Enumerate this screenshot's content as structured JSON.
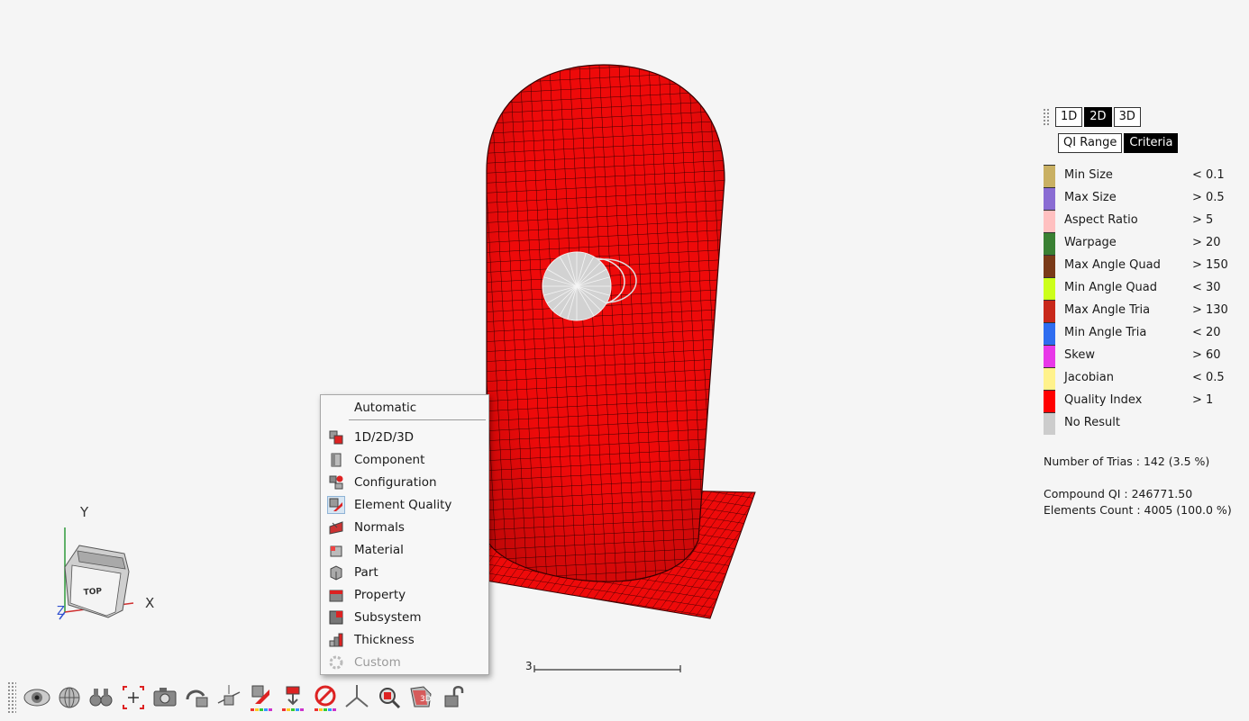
{
  "dimension_tabs": [
    {
      "label": "1D",
      "active": false
    },
    {
      "label": "2D",
      "active": true
    },
    {
      "label": "3D",
      "active": false
    }
  ],
  "mode_tabs": [
    {
      "label": "QI Range",
      "active": false
    },
    {
      "label": "Criteria",
      "active": true
    }
  ],
  "legend": [
    {
      "label": "Min Size",
      "op": "<",
      "value": "0.1",
      "color": "#c9b063"
    },
    {
      "label": "Max Size",
      "op": ">",
      "value": "0.5",
      "color": "#8a6cd3"
    },
    {
      "label": "Aspect Ratio",
      "op": ">",
      "value": "5",
      "color": "#ffc0c0"
    },
    {
      "label": "Warpage",
      "op": ">",
      "value": "20",
      "color": "#3a8033"
    },
    {
      "label": "Max Angle Quad",
      "op": ">",
      "value": "150",
      "color": "#7a3a18"
    },
    {
      "label": "Min Angle Quad",
      "op": "<",
      "value": "30",
      "color": "#ccff1a"
    },
    {
      "label": "Max Angle Tria",
      "op": ">",
      "value": "130",
      "color": "#c8281a"
    },
    {
      "label": "Min Angle Tria",
      "op": "<",
      "value": "20",
      "color": "#2f6df0"
    },
    {
      "label": "Skew",
      "op": ">",
      "value": "60",
      "color": "#e838e8"
    },
    {
      "label": "Jacobian",
      "op": "<",
      "value": "0.5",
      "color": "#fff28c"
    },
    {
      "label": "Quality Index",
      "op": ">",
      "value": "1",
      "color": "#ff0000"
    },
    {
      "label": "No Result",
      "op": "",
      "value": "",
      "color": "#cccccc"
    }
  ],
  "stats": {
    "trias": "Number of Trias : 142 (3.5 %)",
    "compound_qi": "Compound QI : 246771.50",
    "elements_count": "Elements Count : 4005 (100.0 %)"
  },
  "menu": {
    "header": "Automatic",
    "items": [
      {
        "label": "1D/2D/3D",
        "icon": "dimension-icon",
        "enabled": true,
        "current": false
      },
      {
        "label": "Component",
        "icon": "component-icon",
        "enabled": true,
        "current": false
      },
      {
        "label": "Configuration",
        "icon": "configuration-icon",
        "enabled": true,
        "current": false
      },
      {
        "label": "Element Quality",
        "icon": "element-quality-icon",
        "enabled": true,
        "current": true
      },
      {
        "label": "Normals",
        "icon": "normals-icon",
        "enabled": true,
        "current": false
      },
      {
        "label": "Material",
        "icon": "material-icon",
        "enabled": true,
        "current": false
      },
      {
        "label": "Part",
        "icon": "part-icon",
        "enabled": true,
        "current": false
      },
      {
        "label": "Property",
        "icon": "property-icon",
        "enabled": true,
        "current": false
      },
      {
        "label": "Subsystem",
        "icon": "subsystem-icon",
        "enabled": true,
        "current": false
      },
      {
        "label": "Thickness",
        "icon": "thickness-icon",
        "enabled": true,
        "current": false
      },
      {
        "label": "Custom",
        "icon": "custom-icon",
        "enabled": false,
        "current": false
      }
    ]
  },
  "viewcube": {
    "face_label": "TOP",
    "x_axis": "X",
    "y_axis": "Y",
    "z_axis": "Z"
  },
  "scale_bar": {
    "label": "3"
  },
  "toolbar": [
    "eye-icon",
    "globe-icon",
    "binoculars-icon",
    "fit-view-icon",
    "camera-icon",
    "rotate-icon",
    "section-icon",
    "color-by-icon",
    "legend-icon",
    "no-color-icon",
    "axes-icon",
    "zoom-icon",
    "3d-view-icon",
    "unlock-icon"
  ]
}
